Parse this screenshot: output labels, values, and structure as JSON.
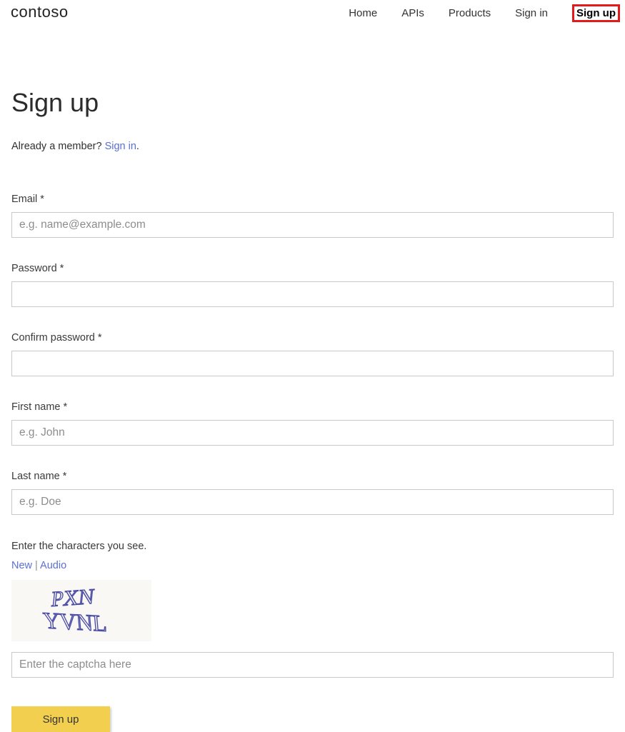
{
  "header": {
    "logo_text": "contoso",
    "nav": {
      "home": "Home",
      "apis": "APIs",
      "products": "Products",
      "sign_in": "Sign in",
      "sign_up": "Sign up"
    }
  },
  "page": {
    "title": "Sign up",
    "member_text": "Already a member? ",
    "member_link": "Sign in",
    "member_suffix": "."
  },
  "fields": {
    "email": {
      "label": "Email *",
      "placeholder": "e.g. name@example.com"
    },
    "password": {
      "label": "Password *",
      "placeholder": ""
    },
    "confirm": {
      "label": "Confirm password *",
      "placeholder": ""
    },
    "first_name": {
      "label": "First name *",
      "placeholder": "e.g. John"
    },
    "last_name": {
      "label": "Last name *",
      "placeholder": "e.g. Doe"
    }
  },
  "captcha": {
    "label": "Enter the characters you see.",
    "link_new": "New",
    "separator": "  |  ",
    "link_audio": "Audio",
    "image_line1": "PXN",
    "image_line2": "YVNL",
    "input_placeholder": "Enter the captcha here"
  },
  "submit_label": "Sign up"
}
